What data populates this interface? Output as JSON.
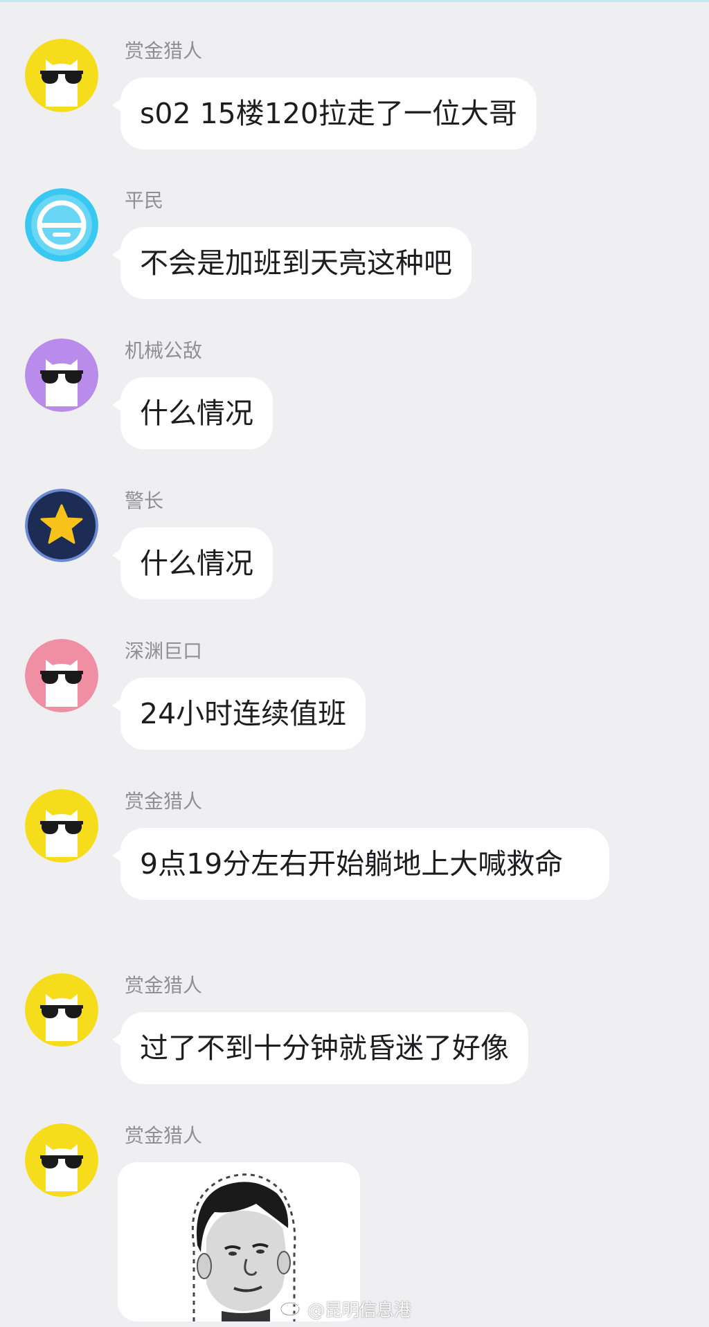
{
  "messages": [
    {
      "name": "赏金猎人",
      "text": "s02 15楼120拉走了一位大哥",
      "avatar": "cat-sunglasses-yellow"
    },
    {
      "name": "平民",
      "text": "不会是加班到天亮这种吧",
      "avatar": "civilian-hat-blue"
    },
    {
      "name": "机械公敌",
      "text": "什么情况",
      "avatar": "cat-sunglasses-purple"
    },
    {
      "name": "警长",
      "text": "什么情况",
      "avatar": "star-navy"
    },
    {
      "name": "深渊巨口",
      "text": "24小时连续值班",
      "avatar": "cat-sunglasses-pink"
    },
    {
      "name": "赏金猎人",
      "text": "9点19分左右开始躺地上大喊救命",
      "avatar": "cat-sunglasses-yellow"
    },
    {
      "name": "赏金猎人",
      "text": "过了不到十分钟就昏迷了好像",
      "avatar": "cat-sunglasses-yellow"
    },
    {
      "name": "赏金猎人",
      "text": "",
      "avatar": "cat-sunglasses-yellow",
      "sticker": "meme-face-sticker"
    }
  ],
  "watermark": {
    "text": "@昆明信息港",
    "icon": "weibo-icon"
  },
  "colors": {
    "yellow": "#f5dd1c",
    "purple": "#b98bea",
    "pink": "#f08fa3",
    "blue": "#39c8f2",
    "navy": "#1d2c54",
    "star": "#f7c31a"
  }
}
